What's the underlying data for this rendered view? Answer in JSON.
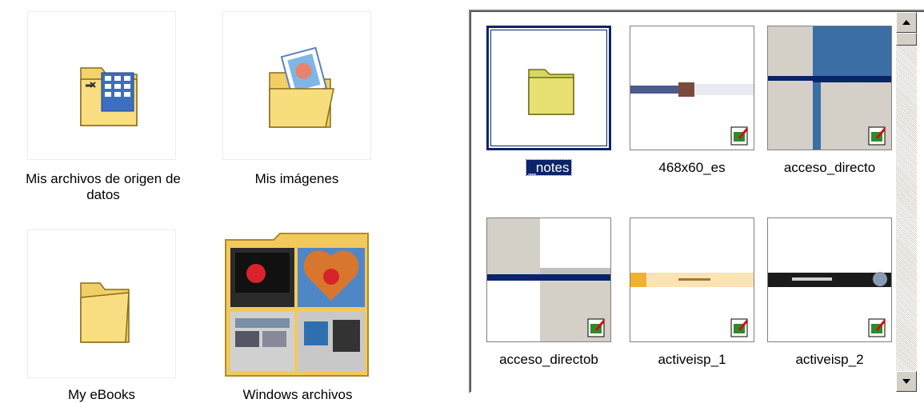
{
  "left_items": [
    {
      "label": "Mis archivos de origen de\ndatos",
      "icon": "data-sources-folder-icon"
    },
    {
      "label": "Mis imágenes",
      "icon": "pictures-folder-icon"
    },
    {
      "label": "My eBooks",
      "icon": "folder-icon"
    },
    {
      "label": "Windows  archivos",
      "icon": "windows-files-folder-icon"
    }
  ],
  "right_items": [
    {
      "label": "_notes",
      "selected": true
    },
    {
      "label": "468x60_es"
    },
    {
      "label": "acceso_directo"
    },
    {
      "label": "acceso_directob"
    },
    {
      "label": "activeisp_1"
    },
    {
      "label": "activeisp_2"
    }
  ],
  "colors": {
    "selection": "#0a246a",
    "folder": "#e8e070",
    "banner_blue": "#3a6ea5"
  }
}
